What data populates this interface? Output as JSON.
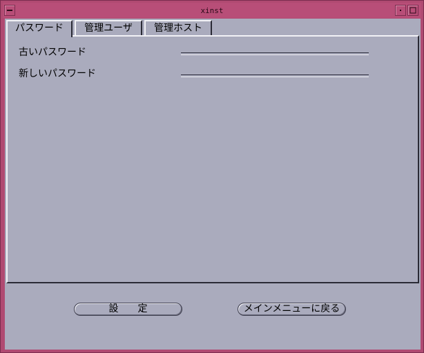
{
  "window": {
    "title": "xinst"
  },
  "titlebar_buttons": {
    "menu_icon": "window-menu-icon",
    "minimize_icon": "minimize-icon",
    "maximize_icon": "maximize-icon"
  },
  "tabs": [
    {
      "label": "パスワード",
      "active": true
    },
    {
      "label": "管理ユーザ",
      "active": false
    },
    {
      "label": "管理ホスト",
      "active": false
    }
  ],
  "form": {
    "old_password_label": "古いパスワード",
    "old_password_value": "",
    "new_password_label": "新しいパスワード",
    "new_password_value": ""
  },
  "buttons": {
    "set_label": "設　　定",
    "return_label": "メインメニューに戻る"
  },
  "colors": {
    "frame": "#b04a72",
    "background": "#aaabbd"
  }
}
